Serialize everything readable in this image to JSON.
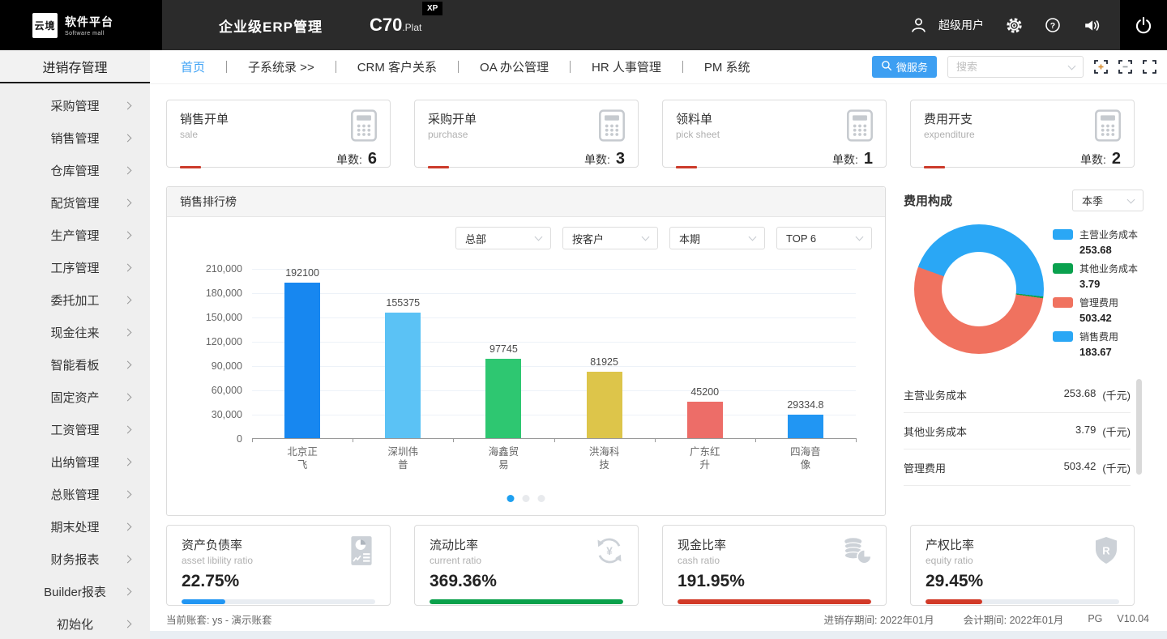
{
  "topbar": {
    "logo_primary": "云境",
    "logo_secondary": "软件平台",
    "logo_sub": "Software mall",
    "product_title": "企业级ERP管理",
    "product_code": "C70",
    "product_suffix": ".Plat",
    "product_badge": "XP",
    "user_name": "超级用户",
    "icons": [
      "user-icon",
      "gear-icon",
      "help-icon",
      "speaker-icon",
      "power-icon"
    ]
  },
  "nav": {
    "sidebar_title": "进销存管理",
    "items": [
      {
        "label": "首页",
        "active": true
      },
      {
        "label": "子系统录 >>",
        "active": false
      },
      {
        "label": "CRM 客户关系",
        "active": false
      },
      {
        "label": "OA 办公管理",
        "active": false
      },
      {
        "label": "HR 人事管理",
        "active": false
      },
      {
        "label": "PM 系统",
        "active": false
      }
    ],
    "microservice_label": "微服务",
    "search_placeholder": "搜索",
    "window_icons": [
      "zoom-in-icon",
      "zoom-out-icon",
      "fullscreen-icon"
    ]
  },
  "sidebar": {
    "items": [
      "采购管理",
      "销售管理",
      "仓库管理",
      "配货管理",
      "生产管理",
      "工序管理",
      "委托加工",
      "现金往来",
      "智能看板",
      "固定资产",
      "工资管理",
      "出纳管理",
      "总账管理",
      "期末处理",
      "财务报表",
      "Builder报表",
      "初始化"
    ]
  },
  "stat_cards": [
    {
      "title": "销售开单",
      "subtitle": "sale",
      "count_label": "单数:",
      "count": "6",
      "icon": "calculator-icon"
    },
    {
      "title": "采购开单",
      "subtitle": "purchase",
      "count_label": "单数:",
      "count": "3",
      "icon": "calculator-icon"
    },
    {
      "title": "领料单",
      "subtitle": "pick sheet",
      "count_label": "单数:",
      "count": "1",
      "icon": "calculator-icon"
    },
    {
      "title": "费用开支",
      "subtitle": "expenditure",
      "count_label": "单数:",
      "count": "2",
      "icon": "calculator-icon"
    }
  ],
  "chart_panel": {
    "title": "销售排行榜",
    "filters": [
      "总部",
      "按客户",
      "本期",
      "TOP 6"
    ],
    "pagination_dots": 3,
    "active_dot": 0
  },
  "chart_data": [
    {
      "type": "bar",
      "title": "销售排行榜",
      "categories": [
        "北京正飞",
        "深圳伟普",
        "海鑫贸易",
        "洪海科技",
        "广东红升",
        "四海音像"
      ],
      "values": [
        192100,
        155375,
        97745,
        81925,
        45200,
        29334.8
      ],
      "data_labels": [
        "192100",
        "155375",
        "97745",
        "81925",
        "45200",
        "29334.8"
      ],
      "bar_colors": [
        "#1787f0",
        "#5bc2f5",
        "#2ec771",
        "#ddc54a",
        "#ed6d68",
        "#2196f3"
      ],
      "xlabel": "",
      "ylabel": "",
      "ylim": [
        0,
        210000
      ],
      "ytick_step": 30000,
      "ytick_labels": [
        "0",
        "30,000",
        "60,000",
        "90,000",
        "120,000",
        "150,000",
        "180,000",
        "210,000"
      ],
      "grid": true,
      "legend_position": "none"
    },
    {
      "type": "pie",
      "title": "费用构成",
      "donut": true,
      "labels": [
        "主营业务成本",
        "其他业务成本",
        "管理费用",
        "销售费用"
      ],
      "values": [
        253.68,
        3.79,
        503.42,
        183.67
      ],
      "colors": [
        "#2aa7f5",
        "#0aa14e",
        "#f0725f",
        "#2aa7f5"
      ],
      "legend_position": "right",
      "unit": "千元"
    }
  ],
  "expense_panel": {
    "title": "费用构成",
    "period": "本季",
    "rows": [
      {
        "label": "主营业务成本",
        "value": "253.68",
        "unit": "(千元)"
      },
      {
        "label": "其他业务成本",
        "value": "3.79",
        "unit": "(千元)"
      },
      {
        "label": "管理费用",
        "value": "503.42",
        "unit": "(千元)"
      }
    ]
  },
  "ratio_cards": [
    {
      "title": "资产负债率",
      "subtitle": "asset libility ratio",
      "value": "22.75%",
      "percent": 22.75,
      "bar_color": "#2196f3",
      "icon": "report-icon"
    },
    {
      "title": "流动比率",
      "subtitle": "current ratio",
      "value": "369.36%",
      "percent": 100,
      "bar_color": "#0aa14b",
      "icon": "refresh-yen-icon"
    },
    {
      "title": "现金比率",
      "subtitle": "cash ratio",
      "value": "191.95%",
      "percent": 100,
      "bar_color": "#d23a28",
      "icon": "coins-icon"
    },
    {
      "title": "产权比率",
      "subtitle": "equity ratio",
      "value": "29.45%",
      "percent": 29.45,
      "bar_color": "#d23a28",
      "icon": "shield-icon"
    }
  ],
  "statusbar": {
    "left": "当前账套: ys - 演示账套",
    "period1": "进销存期间: 2022年01月",
    "period2": "会计期间: 2022年01月",
    "db": "PG",
    "version": "V10.04"
  },
  "colors": {
    "accent_blue": "#3d9ff2",
    "topbar_bg": "#2b2b2b",
    "card_red_dash": "#cc3b2b",
    "pagination_active": "#1ea0f0"
  }
}
